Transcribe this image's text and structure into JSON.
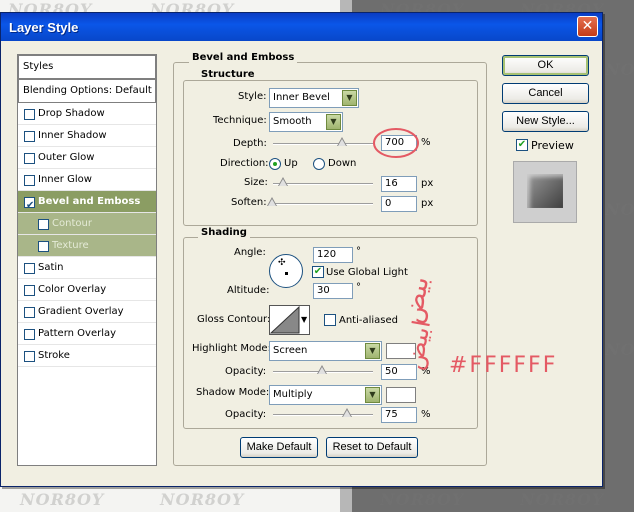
{
  "watermark": "NOR8OY",
  "dialog": {
    "title": "Layer Style",
    "close_icon": "close-icon"
  },
  "styles_panel": {
    "header": "Styles",
    "blending": "Blending Options: Default",
    "items": [
      {
        "label": "Drop Shadow",
        "checked": false
      },
      {
        "label": "Inner Shadow",
        "checked": false
      },
      {
        "label": "Outer Glow",
        "checked": false
      },
      {
        "label": "Inner Glow",
        "checked": false
      },
      {
        "label": "Bevel and Emboss",
        "checked": true,
        "selected": true
      },
      {
        "label": "Contour",
        "checked": false,
        "sub": true
      },
      {
        "label": "Texture",
        "checked": false,
        "sub": true
      },
      {
        "label": "Satin",
        "checked": false
      },
      {
        "label": "Color Overlay",
        "checked": false
      },
      {
        "label": "Gradient Overlay",
        "checked": false
      },
      {
        "label": "Pattern Overlay",
        "checked": false
      },
      {
        "label": "Stroke",
        "checked": false
      }
    ]
  },
  "bevel": {
    "group_title": "Bevel and Emboss",
    "structure_title": "Structure",
    "style_label": "Style:",
    "style_value": "Inner Bevel",
    "technique_label": "Technique:",
    "technique_value": "Smooth",
    "depth_label": "Depth:",
    "depth_value": "700",
    "depth_unit": "%",
    "direction_label": "Direction:",
    "direction_up": "Up",
    "direction_down": "Down",
    "size_label": "Size:",
    "size_value": "16",
    "size_unit": "px",
    "soften_label": "Soften:",
    "soften_value": "0",
    "soften_unit": "px"
  },
  "shading": {
    "title": "Shading",
    "angle_label": "Angle:",
    "angle_value": "120",
    "angle_unit": "°",
    "global_light_label": "Use Global Light",
    "global_light_checked": true,
    "altitude_label": "Altitude:",
    "altitude_value": "30",
    "altitude_unit": "°",
    "gloss_label": "Gloss Contour:",
    "antialiased_label": "Anti-aliased",
    "highlight_mode_label": "Highlight Mode:",
    "highlight_mode_value": "Screen",
    "highlight_color": "#ffffff",
    "highlight_opacity_label": "Opacity:",
    "highlight_opacity_value": "50",
    "highlight_opacity_unit": "%",
    "shadow_mode_label": "Shadow Mode:",
    "shadow_mode_value": "Multiply",
    "shadow_color": "#ffffff",
    "shadow_opacity_label": "Opacity:",
    "shadow_opacity_value": "75",
    "shadow_opacity_unit": "%"
  },
  "buttons": {
    "make_default": "Make Default",
    "reset_default": "Reset to Default",
    "ok": "OK",
    "cancel": "Cancel",
    "new_style": "New Style...",
    "preview": "Preview",
    "preview_checked": true
  },
  "annotations": {
    "color_note": "#FFFFFF",
    "arabic_top": "بيض",
    "arabic_bottom": "ابيض",
    "color": "#e45a64"
  },
  "colors": {
    "title_bar": "#0a56e8",
    "selected_item": "#8b9d63",
    "dialog_bg": "#f1efe2"
  }
}
